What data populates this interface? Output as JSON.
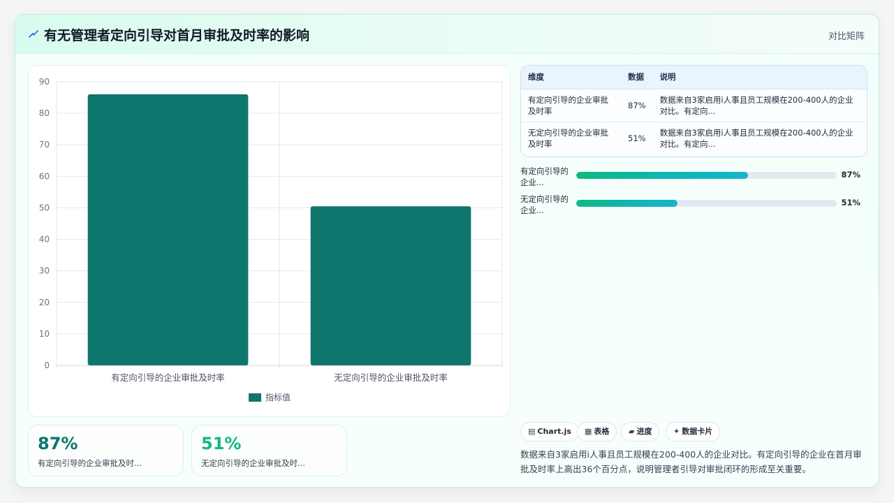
{
  "header": {
    "title": "有无管理者定向引导对首月审批及时率的影响",
    "mode_link": "对比矩阵"
  },
  "chart_data": {
    "type": "bar",
    "categories": [
      "有定向引导的企业审批及时率",
      "无定向引导的企业审批及时率"
    ],
    "series": [
      {
        "name": "指标值",
        "values": [
          86,
          50.5
        ]
      }
    ],
    "ylim": [
      0,
      90
    ],
    "y_ticks": [
      "0",
      "10",
      "20",
      "30",
      "40",
      "50",
      "60",
      "70",
      "80",
      "90"
    ],
    "grid": true,
    "legend_position": "bottom",
    "bar_color": "#0f766e"
  },
  "stats": [
    {
      "value": "87%",
      "label": "有定向引导的企业审批及时...",
      "color": "#0f766e"
    },
    {
      "value": "51%",
      "label": "无定向引导的企业审批及时...",
      "color": "#10b981"
    }
  ],
  "table": {
    "headers": [
      "维度",
      "数据",
      "说明"
    ],
    "rows": [
      [
        "有定向引导的企业审批及时率",
        "87%",
        "数据来自3家启用i人事且员工规模在200-400人的企业对比。有定向..."
      ],
      [
        "无定向引导的企业审批及时率",
        "51%",
        "数据来自3家启用i人事且员工规模在200-400人的企业对比。有定向..."
      ]
    ]
  },
  "progress": [
    {
      "label": "有定向引导的企业...",
      "value_text": "87%",
      "fraction": 0.66
    },
    {
      "label": "无定向引导的企业...",
      "value_text": "51%",
      "fraction": 0.39
    }
  ],
  "chips": [
    {
      "icon": "chart-icon",
      "glyph": "▤",
      "label": "Chart.js"
    },
    {
      "icon": "table-icon",
      "glyph": "▦",
      "label": "表格"
    },
    {
      "icon": "progress-icon",
      "glyph": "▰",
      "label": "进度"
    },
    {
      "icon": "sparkle-icon",
      "glyph": "✦",
      "label": "数据卡片"
    }
  ],
  "summary": "数据来自3家启用i人事且员工规模在200-400人的企业对比。有定向引导的企业在首月审批及时率上高出36个百分点，说明管理者引导对审批闭环的形成至关重要。",
  "colors": {
    "accent": "#0f766e",
    "accent2": "#10b981",
    "border": "#bfeee0"
  }
}
